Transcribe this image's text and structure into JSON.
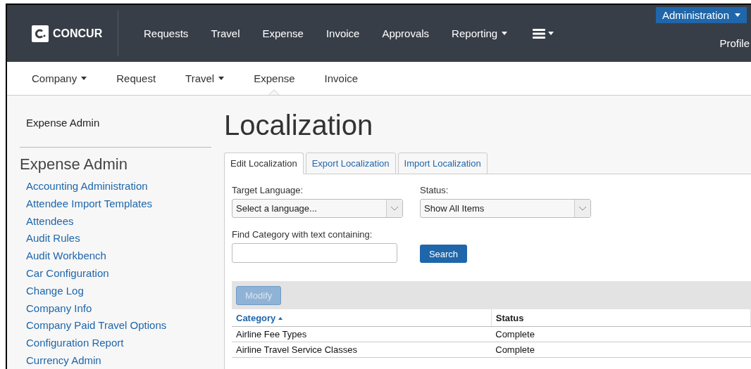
{
  "top_nav": {
    "brand": "CONCUR",
    "items": [
      {
        "label": "Requests",
        "dropdown": false
      },
      {
        "label": "Travel",
        "dropdown": false
      },
      {
        "label": "Expense",
        "dropdown": false
      },
      {
        "label": "Invoice",
        "dropdown": false
      },
      {
        "label": "Approvals",
        "dropdown": false
      },
      {
        "label": "Reporting",
        "dropdown": true
      }
    ],
    "admin_button": "Administration",
    "profile": "Profile"
  },
  "sub_nav": {
    "items": [
      {
        "label": "Company",
        "dropdown": true,
        "selected": false
      },
      {
        "label": "Request",
        "dropdown": false,
        "selected": false
      },
      {
        "label": "Travel",
        "dropdown": true,
        "selected": false
      },
      {
        "label": "Expense",
        "dropdown": false,
        "selected": true
      },
      {
        "label": "Invoice",
        "dropdown": false,
        "selected": false
      }
    ]
  },
  "sidebar": {
    "top_link": "Expense Admin",
    "heading": "Expense Admin",
    "items": [
      "Accounting Administration",
      "Attendee Import Templates",
      "Attendees",
      "Audit Rules",
      "Audit Workbench",
      "Car Configuration",
      "Change Log",
      "Company Info",
      "Company Paid Travel Options",
      "Configuration Report",
      "Currency Admin"
    ]
  },
  "page": {
    "title": "Localization",
    "tabs": [
      {
        "label": "Edit Localization",
        "selected": true
      },
      {
        "label": "Export Localization",
        "selected": false
      },
      {
        "label": "Import Localization",
        "selected": false
      }
    ],
    "target_language": {
      "label": "Target Language:",
      "value": "Select a language..."
    },
    "status": {
      "label": "Status:",
      "value": "Show All Items"
    },
    "find": {
      "label": "Find Category with text containing:"
    },
    "search_button": "Search",
    "modify_button": {
      "label": "Modify",
      "disabled": true
    },
    "table": {
      "columns": [
        {
          "label": "Category",
          "sorted": true
        },
        {
          "label": "Status",
          "sorted": false
        }
      ],
      "rows": [
        [
          "Airline Fee Types",
          "Complete"
        ],
        [
          "Airline Travel Service Classes",
          "Complete"
        ]
      ]
    }
  }
}
